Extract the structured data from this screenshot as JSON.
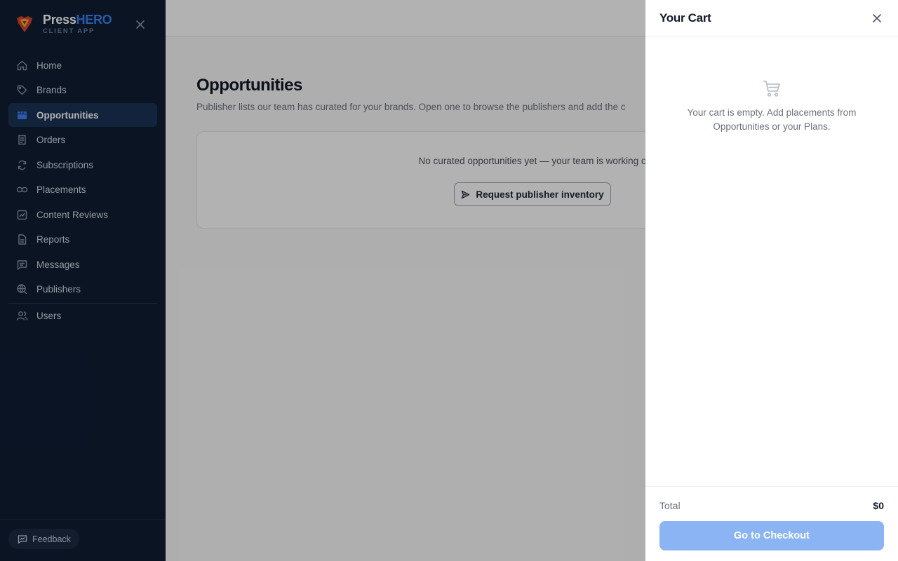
{
  "brand": {
    "name_part1": "Press",
    "name_part2": "HERO",
    "subtitle": "CLIENT APP",
    "logo_icon": "superhero-shield-logo",
    "accent_color": "#3b82f6"
  },
  "sidebar": {
    "close_icon": "close-icon",
    "items": [
      {
        "label": "Home",
        "icon": "home-icon"
      },
      {
        "label": "Brands",
        "icon": "tag-icon"
      },
      {
        "label": "Opportunities",
        "icon": "storefront-icon",
        "active": true
      },
      {
        "label": "Orders",
        "icon": "receipt-icon"
      },
      {
        "label": "Subscriptions",
        "icon": "refresh-icon"
      },
      {
        "label": "Placements",
        "icon": "link-icon"
      },
      {
        "label": "Content Reviews",
        "icon": "review-chart-icon"
      },
      {
        "label": "Reports",
        "icon": "document-icon"
      },
      {
        "label": "Messages",
        "icon": "message-icon"
      },
      {
        "label": "Publishers",
        "icon": "globe-search-icon"
      }
    ],
    "secondary_items": [
      {
        "label": "Users",
        "icon": "users-icon"
      }
    ],
    "feedback_label": "Feedback"
  },
  "main": {
    "title": "Opportunities",
    "description": "Publisher lists our team has curated for your brands. Open one to browse the publishers and add the c",
    "empty_message": "No curated opportunities yet — your team is working o",
    "request_button_label": "Request publisher inventory"
  },
  "cart": {
    "title": "Your Cart",
    "empty_text": "Your cart is empty. Add placements from Opportunities or your Plans.",
    "total_label": "Total",
    "total_value": "$0",
    "checkout_label": "Go to Checkout",
    "checkout_color": "#8ab4f4"
  }
}
